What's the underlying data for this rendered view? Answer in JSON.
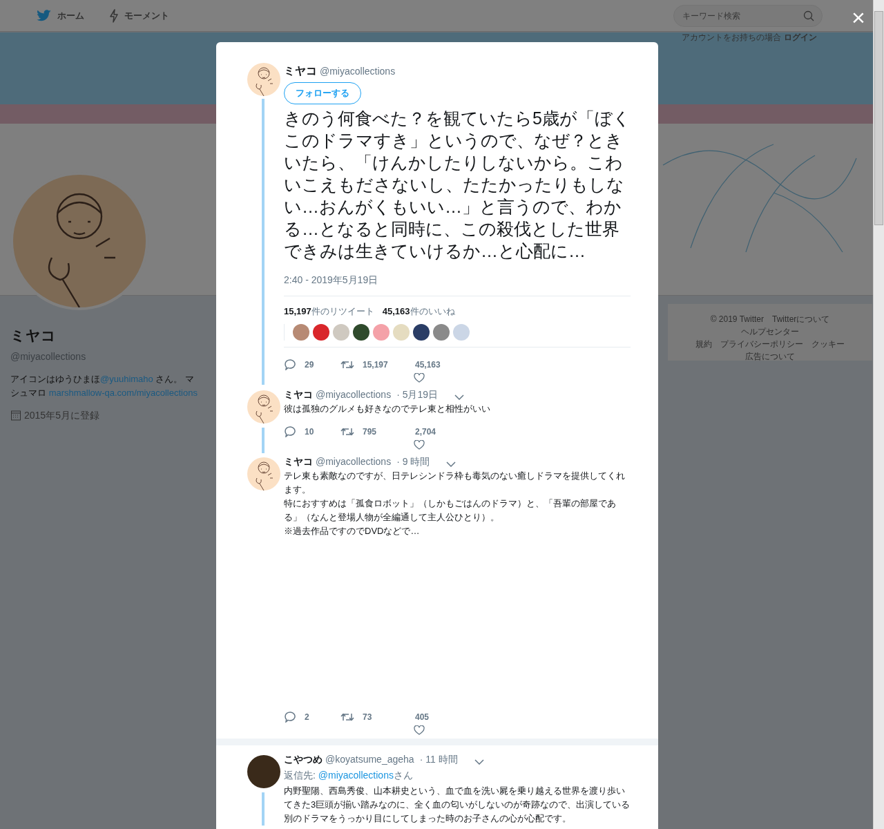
{
  "nav": {
    "items": [
      {
        "label": "ホーム"
      },
      {
        "label": "モーメント"
      }
    ],
    "search": {
      "placeholder": "キーワード検索"
    },
    "login_prompt": "アカウントをお持ちの場合",
    "login": "ログイン"
  },
  "profile": {
    "name": "ミヤコ",
    "handle": "@miyacollections",
    "bio": [
      {
        "text": "アイコンはゆうひまほ",
        "link": false
      },
      {
        "text": "@yuuhimaho",
        "link": true
      },
      {
        "text": " さん。 マシュマロ ",
        "link": false
      },
      {
        "text": "marshmallow-qa.com/miyacollections",
        "link": true
      }
    ],
    "joined": "2015年5月に登録"
  },
  "footer": [
    "© 2019 Twitter",
    "Twitterについて",
    "ヘルプセンター",
    "規約",
    "プライバシーポリシー",
    "クッキー",
    "広告について"
  ],
  "close": "×",
  "main_tweet": {
    "name": "ミヤコ",
    "handle": "@miyacollections",
    "follow": "フォローする",
    "text": "きのう何食べた？を観ていたら5歳が「ぼくこのドラマすき」というので、なぜ？ときいたら、「けんかしたりしないから。こわいこえもださないし、たたかったりもしない…おんがくもいい…」と言うので、わかる…となると同時に、この殺伐とした世界できみは生きていけるか…と心配に…",
    "time": "2:40 - 2019年5月19日",
    "retweet_count": "15,197",
    "retweet_label": "件のリツイート",
    "like_count": "45,163",
    "like_label": "件のいいね",
    "replies": "29",
    "retweets": "15,197",
    "likes": "45,163"
  },
  "replies": [
    {
      "name": "ミヤコ",
      "handle": "@miyacollections",
      "time": "· 5月19日",
      "thread": true,
      "paragraphs": [
        "彼は孤独のグルメも好きなのでテレ東と相性がいい"
      ],
      "replies": "10",
      "retweets": "795",
      "likes": "2,704"
    },
    {
      "name": "ミヤコ",
      "handle": "@miyacollections",
      "time": "· 9 時間",
      "thread": false,
      "paragraphs": [
        "テレ東も素敵なのですが、日テレシンドラ枠も毒気のない癒しドラマを提供してくれます。",
        "特におすすめは「孤食ロボット」（しかもごはんのドラマ）と、「吾輩の部屋である」（なんと登場人物が全編通して主人公ひとり）。",
        "※過去作品ですのでDVDなどで…"
      ],
      "replies": "2",
      "retweets": "73",
      "likes": "405"
    },
    {
      "name": "こやつめ",
      "handle": "@koyatsume_ageha",
      "time": "· 11 時間",
      "thread": true,
      "reply_to": {
        "prefix": "返信先: ",
        "handle": "@miyacollections",
        "suffix": "さん"
      },
      "paragraphs": [
        "内野聖陽、西島秀俊、山本耕史という、血で血を洗い屍を乗り越える世界を渡り歩いてきた3巨頭が揃い踏みなのに、全く血の匂いがしないのが奇跡なので、出演している別のドラマをうっかり目にしてしまった時のお子さんの心が心配です。"
      ]
    }
  ]
}
